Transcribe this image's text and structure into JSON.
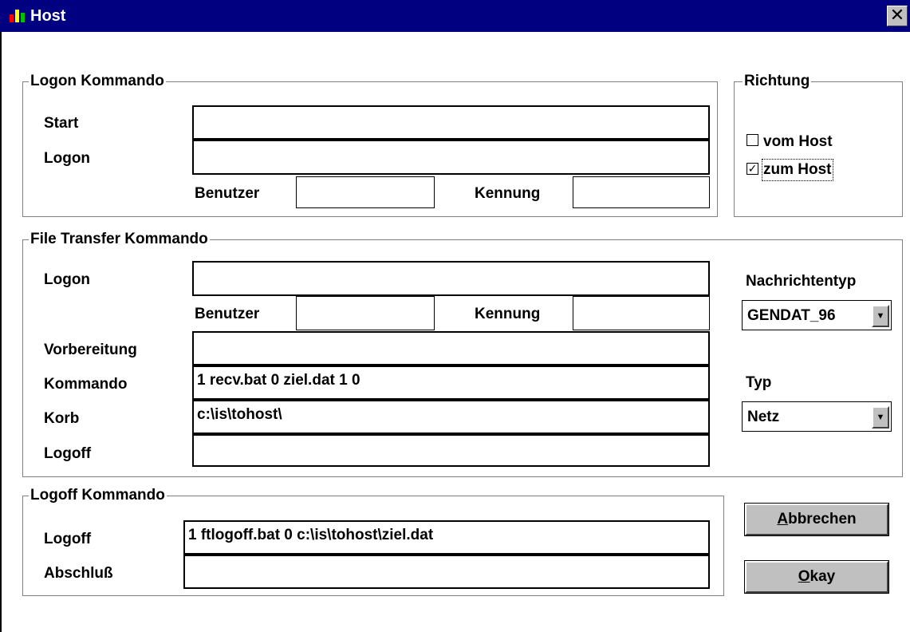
{
  "window": {
    "title": "Host",
    "close_symbol": "✕"
  },
  "logon_group": {
    "title": "Logon Kommando",
    "start_label": "Start",
    "start_value": "",
    "logon_label": "Logon",
    "logon_value": "",
    "benutzer_label": "Benutzer",
    "benutzer_value": "",
    "kennung_label": "Kennung",
    "kennung_value": ""
  },
  "richtung_group": {
    "title": "Richtung",
    "vom_host_label": "vom Host",
    "vom_host_checked": false,
    "zum_host_label": "zum Host",
    "zum_host_checked": true,
    "check_mark": "✓"
  },
  "ft_group": {
    "title": "File Transfer Kommando",
    "logon_label": "Logon",
    "logon_value": "",
    "benutzer_label": "Benutzer",
    "benutzer_value": "",
    "kennung_label": "Kennung",
    "kennung_value": "",
    "vorbereitung_label": "Vorbereitung",
    "vorbereitung_value": "",
    "kommando_label": "Kommando",
    "kommando_value": "1 recv.bat 0 ziel.dat 1 0",
    "korb_label": "Korb",
    "korb_value": "c:\\is\\tohost\\",
    "logoff_label": "Logoff",
    "logoff_value": ""
  },
  "nachrichtentyp": {
    "label": "Nachrichtentyp",
    "value": "GENDAT_96"
  },
  "typ": {
    "label": "Typ",
    "value": "Netz"
  },
  "logoff_group": {
    "title": "Logoff Kommando",
    "logoff_label": "Logoff",
    "logoff_value": "1 ftlogoff.bat 0 c:\\is\\tohost\\ziel.dat",
    "abschluss_label": "Abschluß",
    "abschluss_value": ""
  },
  "buttons": {
    "abbrechen_first": "A",
    "abbrechen_rest": "bbrechen",
    "okay_first": "O",
    "okay_rest": "kay"
  },
  "dropdown_arrow": "▼"
}
